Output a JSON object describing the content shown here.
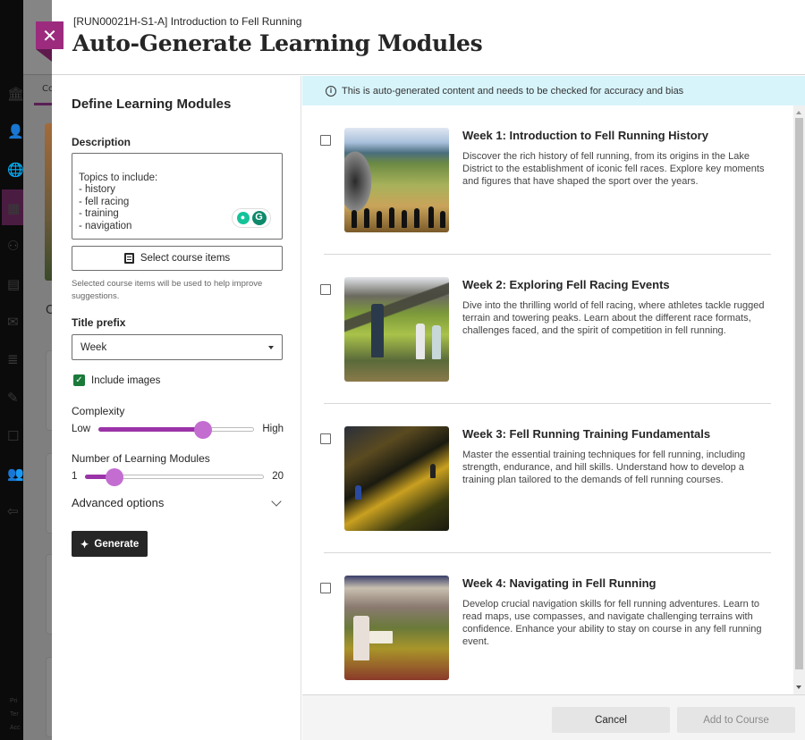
{
  "header": {
    "breadcrumb": "[RUN00021H-S1-A] Introduction to Fell Running",
    "title": "Auto-Generate Learning Modules",
    "close_icon": "close-icon"
  },
  "background": {
    "tab_fragment": "Co",
    "heading_fragment": "C",
    "footer_links": [
      "Pri",
      "Ter",
      "Acc"
    ]
  },
  "form": {
    "title": "Define Learning Modules",
    "description_label": "Description",
    "description_value": "Topics to include:\n- history\n- fell racing\n- training\n- navigation",
    "select_items_label": "Select course items",
    "select_items_help": "Selected course items will be used to help improve suggestions.",
    "title_prefix_label": "Title prefix",
    "title_prefix_value": "Week",
    "include_images_label": "Include images",
    "include_images_checked": true,
    "complexity_label": "Complexity",
    "complexity_min_label": "Low",
    "complexity_max_label": "High",
    "complexity_value_fraction": 0.67,
    "modules_label": "Number of Learning Modules",
    "modules_min": "1",
    "modules_max": "20",
    "modules_value": 4,
    "advanced_label": "Advanced options",
    "generate_label": "Generate"
  },
  "results": {
    "notice": "This is auto-generated content and needs to be checked for accuracy and bias",
    "modules": [
      {
        "title": "Week 1: Introduction to Fell Running History",
        "description": "Discover the rich history of fell running, from its origins in the Lake District to the establishment of iconic fell races. Explore key moments and figures that have shaped the sport over the years.",
        "checked": false
      },
      {
        "title": "Week 2: Exploring Fell Racing Events",
        "description": "Dive into the thrilling world of fell racing, where athletes tackle rugged terrain and towering peaks. Learn about the different race formats, challenges faced, and the spirit of competition in fell running.",
        "checked": false
      },
      {
        "title": "Week 3: Fell Running Training Fundamentals",
        "description": "Master the essential training techniques for fell running, including strength, endurance, and hill skills. Understand how to develop a training plan tailored to the demands of fell running courses.",
        "checked": false
      },
      {
        "title": "Week 4: Navigating in Fell Running",
        "description": "Develop crucial navigation skills for fell running adventures. Learn to read maps, use compasses, and navigate challenging terrains with confidence. Enhance your ability to stay on course in any fell running event.",
        "checked": false
      }
    ],
    "cancel_label": "Cancel",
    "add_label": "Add to Course"
  },
  "colors": {
    "accent": "#9c2b7e",
    "slider_fill": "#9b33a8",
    "slider_thumb": "#c36dd1",
    "notice_bg": "#d7f4fb",
    "checkbox_checked": "#1a7a3a",
    "primary_button": "#262626"
  }
}
